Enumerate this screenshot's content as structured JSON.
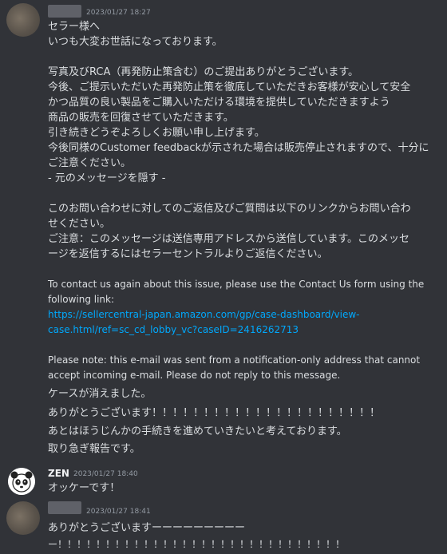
{
  "messages": [
    {
      "timestamp": "2023/01/27 18:27",
      "lines": [
        "セラー様へ",
        "いつも大変お世話になっております。",
        "",
        "写真及びRCA（再発防止策含む）のご提出ありがとうございます。",
        "今後、ご提示いただいた再発防止策を徹底していただきお客様が安心して安全",
        "かつ品質の良い製品をご購入いただける環境を提供していただきますよう",
        "商品の販売を回復させていただきます。",
        "引き続きどうぞよろしくお願い申し上げます。",
        "今後同様のCustomer feedbackが示された場合は販売停止されますので、十分に",
        "ご注意ください。",
        "- 元のメッセージを隠す -",
        "",
        "このお問い合わせに対してのご返信及びご質問は以下のリンクからお問い合わ",
        "せください。",
        "ご注意：このメッセージは送信専用アドレスから送信しています。このメッセ",
        "ージを返信するにはセラーセントラルよりご返信ください。"
      ],
      "english_lines": [
        "To contact us again about this issue, please use the Contact Us form using the",
        "following link:"
      ],
      "link_lines": [
        "https://sellercentral-japan.amazon.com/gp/case-dashboard/view-",
        "case.html/ref=sc_cd_lobby_vc?caseID=2416262713"
      ],
      "note_lines": [
        "Please note: this e-mail was sent from a notification-only address that cannot",
        "accept incoming e-mail. Please do not reply to this message."
      ],
      "followups": [
        "ケースが消えました。",
        "ありがとうございます！！！！！！！！！！！！！！！！！！！！！！",
        "あとはほうじんかの手続きを進めていきたいと考えております。",
        "取り急ぎ報告です。"
      ]
    },
    {
      "username": "ZEN",
      "timestamp": "2023/01/27 18:40",
      "text": "オッケーです！"
    },
    {
      "timestamp": "2023/01/27 18:41",
      "lines": [
        "ありがとうございますーーーーーーーーー",
        "ー！！！！！！！！！！！！！！！！！！！！！！！！！！！！！！"
      ]
    }
  ]
}
